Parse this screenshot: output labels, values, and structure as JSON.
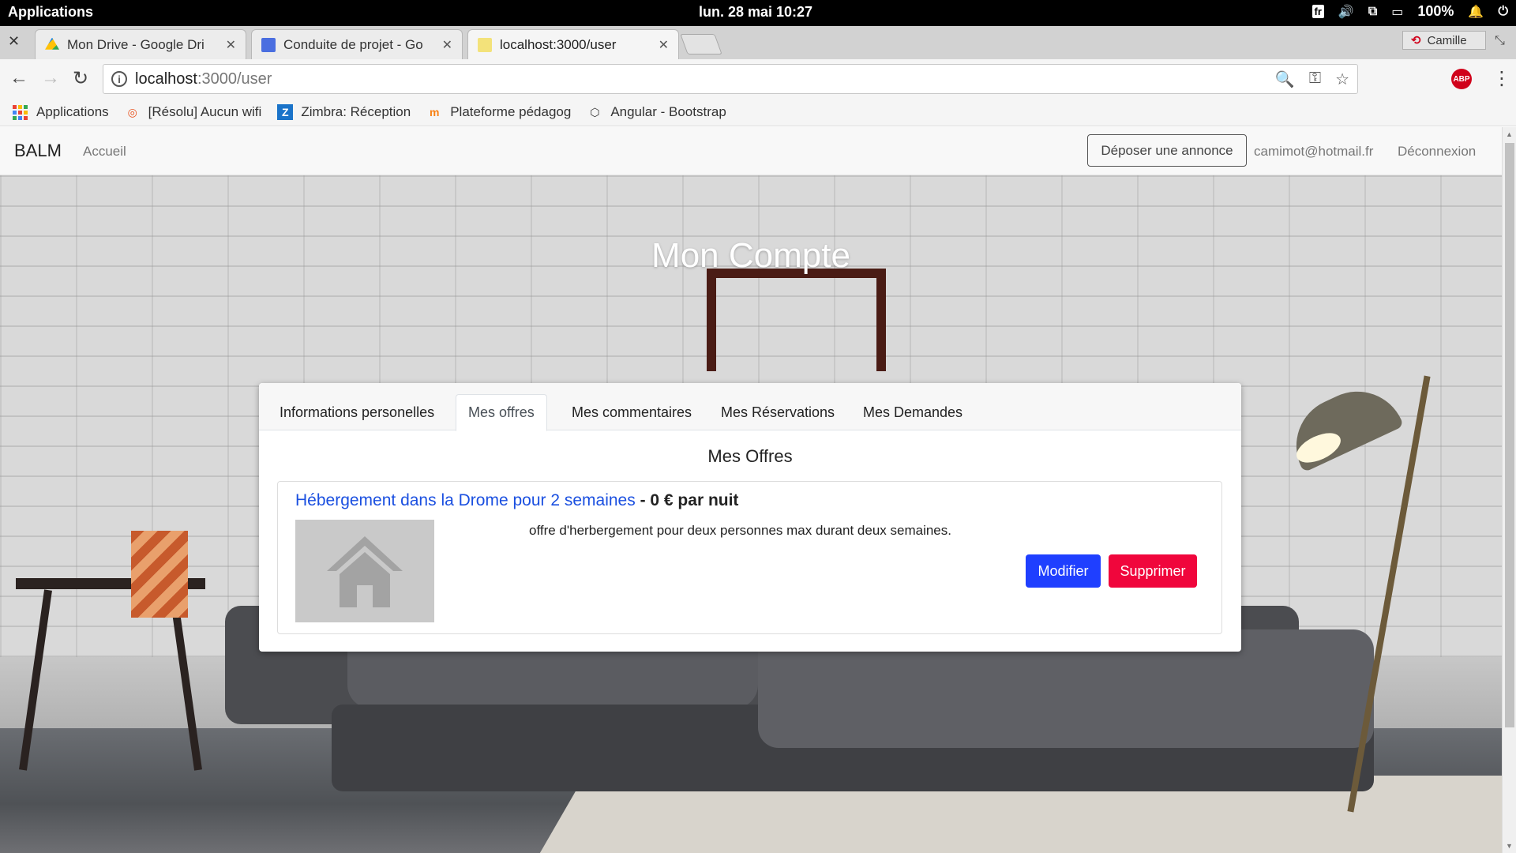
{
  "system": {
    "applications": "Applications",
    "clock": "lun. 28 mai  10:27",
    "lang": "fr",
    "battery": "100%"
  },
  "browser": {
    "tabs": [
      {
        "title": "Mon Drive - Google Dri",
        "icon": "google-drive-icon"
      },
      {
        "title": "Conduite de projet - Go",
        "icon": "google-docs-icon"
      },
      {
        "title": "localhost:3000/user",
        "icon": "page-icon"
      }
    ],
    "profile": "Camille",
    "url_host": "localhost",
    "url_path": ":3000/user",
    "abp": "ABP",
    "bookmarks": [
      {
        "label": "Applications",
        "icon": "apps-grid-icon"
      },
      {
        "label": "[Résolu] Aucun wifi",
        "icon": "ubuntu-icon"
      },
      {
        "label": "Zimbra: Réception",
        "icon": "zimbra-icon"
      },
      {
        "label": "Plateforme pédagog",
        "icon": "moodle-icon"
      },
      {
        "label": "Angular - Bootstrap",
        "icon": "codepen-icon"
      }
    ]
  },
  "navbar": {
    "brand": "BALM",
    "home": "Accueil",
    "post_ad": "Déposer une annonce",
    "email": "camimot@hotmail.fr",
    "logout": "Déconnexion"
  },
  "hero": {
    "title": "Mon Compte"
  },
  "account": {
    "tabs": [
      {
        "label": "Informations personelles"
      },
      {
        "label": "Mes offres"
      },
      {
        "label": "Mes commentaires"
      },
      {
        "label": "Mes Réservations"
      },
      {
        "label": "Mes Demandes"
      }
    ],
    "active_tab": "Mes offres",
    "section_title": "Mes Offres",
    "offers": [
      {
        "title": "Hébergement dans la Drome pour 2 semaines",
        "price": "- 0 € par nuit",
        "description": "offre d'herbergement pour deux personnes max durant deux semaines.",
        "edit": "Modifier",
        "delete": "Supprimer"
      }
    ]
  },
  "colors": {
    "primary": "#1f3fff",
    "danger": "#f0063c",
    "link": "#1a4fe0"
  }
}
